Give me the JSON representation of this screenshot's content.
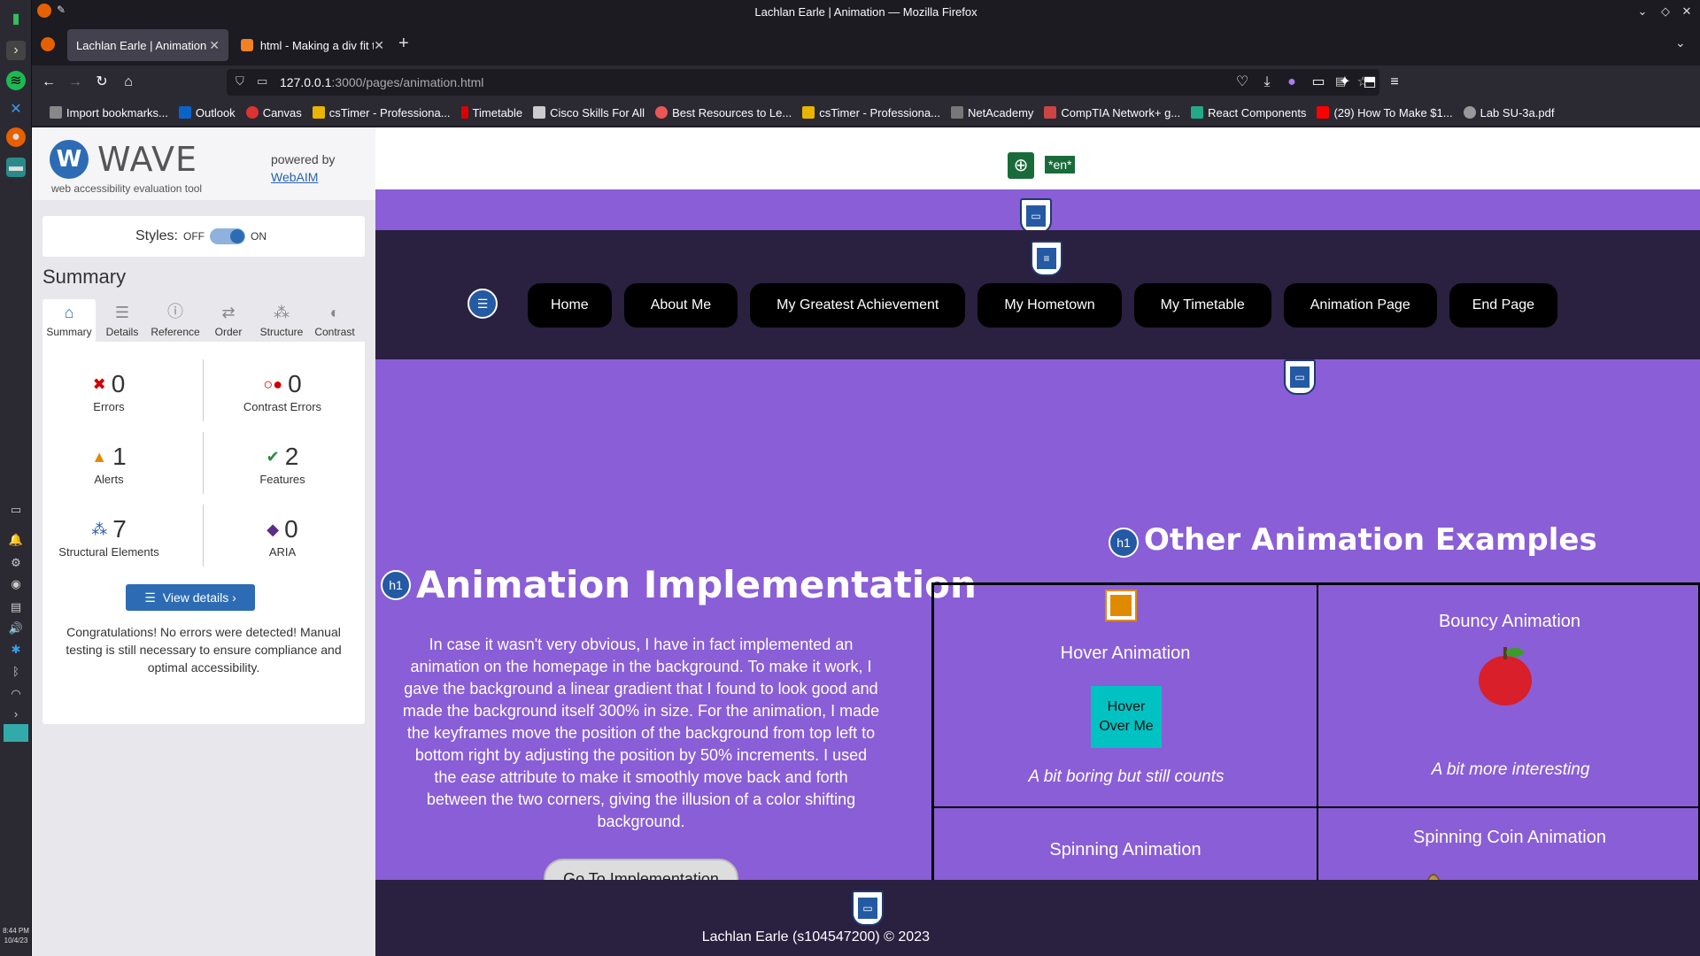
{
  "os": {
    "clock_time": "8:44 PM",
    "clock_date": "10/4/23"
  },
  "browser": {
    "window_title": "Lachlan Earle | Animation — Mozilla Firefox",
    "tabs": [
      {
        "label": "Lachlan Earle | Animation",
        "active": true
      },
      {
        "label": "html - Making a div fit the i",
        "active": false
      }
    ],
    "new_tab": "+",
    "url_host": "127.0.0.1",
    "url_rest": ":3000/pages/animation.html",
    "bookmarks": [
      "Import bookmarks...",
      "Outlook",
      "Canvas",
      "csTimer - Professiona...",
      "Timetable",
      "Cisco Skills For All",
      "Best Resources to Le...",
      "csTimer - Professiona...",
      "NetAcademy",
      "CompTIA Network+ g...",
      "React Components",
      "(29) How To Make $1...",
      "Lab SU-3a.pdf"
    ]
  },
  "wave": {
    "logo_mark": "W",
    "logo_text": "WAVE",
    "tagline": "web accessibility evaluation tool",
    "powered_by": "powered by",
    "webaim": "WebAIM",
    "styles_label": "Styles:",
    "styles_off": "OFF",
    "styles_on": "ON",
    "summary_title": "Summary",
    "tabs": [
      "Summary",
      "Details",
      "Reference",
      "Order",
      "Structure",
      "Contrast"
    ],
    "stats": {
      "errors": {
        "value": "0",
        "label": "Errors"
      },
      "contrast": {
        "value": "0",
        "label": "Contrast Errors"
      },
      "alerts": {
        "value": "1",
        "label": "Alerts"
      },
      "features": {
        "value": "2",
        "label": "Features"
      },
      "structural": {
        "value": "7",
        "label": "Structural Elements"
      },
      "aria": {
        "value": "0",
        "label": "ARIA"
      }
    },
    "view_details": "View details ›",
    "congrats": "Congratulations! No errors were detected! Manual testing is still necessary to ensure compliance and optimal accessibility."
  },
  "page": {
    "lang_badge": "*en*",
    "nav": [
      "Home",
      "About Me",
      "My Greatest Achievement",
      "My Hometown",
      "My Timetable",
      "Animation Page",
      "End Page"
    ],
    "h1_left": "Animation Implementation",
    "intro_before": "In case it wasn't very obvious, I have in fact implemented an animation on the homepage in the background. To make it work, I gave the background a linear gradient that I found to look good and made the background itself 300% in size. For the animation, I made the keyframes move the position of the background from top left to bottom right by adjusting the position by 50% increments. I used the ",
    "intro_em": "ease",
    "intro_after": " attribute to make it smoothly move back and forth between the two corners, giving the illusion of a color shifting background.",
    "go_button": "Go To Implementation",
    "h1_right": "Other Animation Examples",
    "cells": {
      "hover_title": "Hover Animation",
      "hover_box": "Hover Over Me",
      "hover_sub": "A bit boring but still counts",
      "bouncy_title": "Bouncy Animation",
      "bouncy_sub": "A bit more interesting",
      "spin_title": "Spinning Animation",
      "spin_card": ":)",
      "coin_title": "Spinning Coin Animation"
    },
    "footer": "Lachlan Earle (s104547200) © 2023",
    "h1_badge": "h1"
  }
}
